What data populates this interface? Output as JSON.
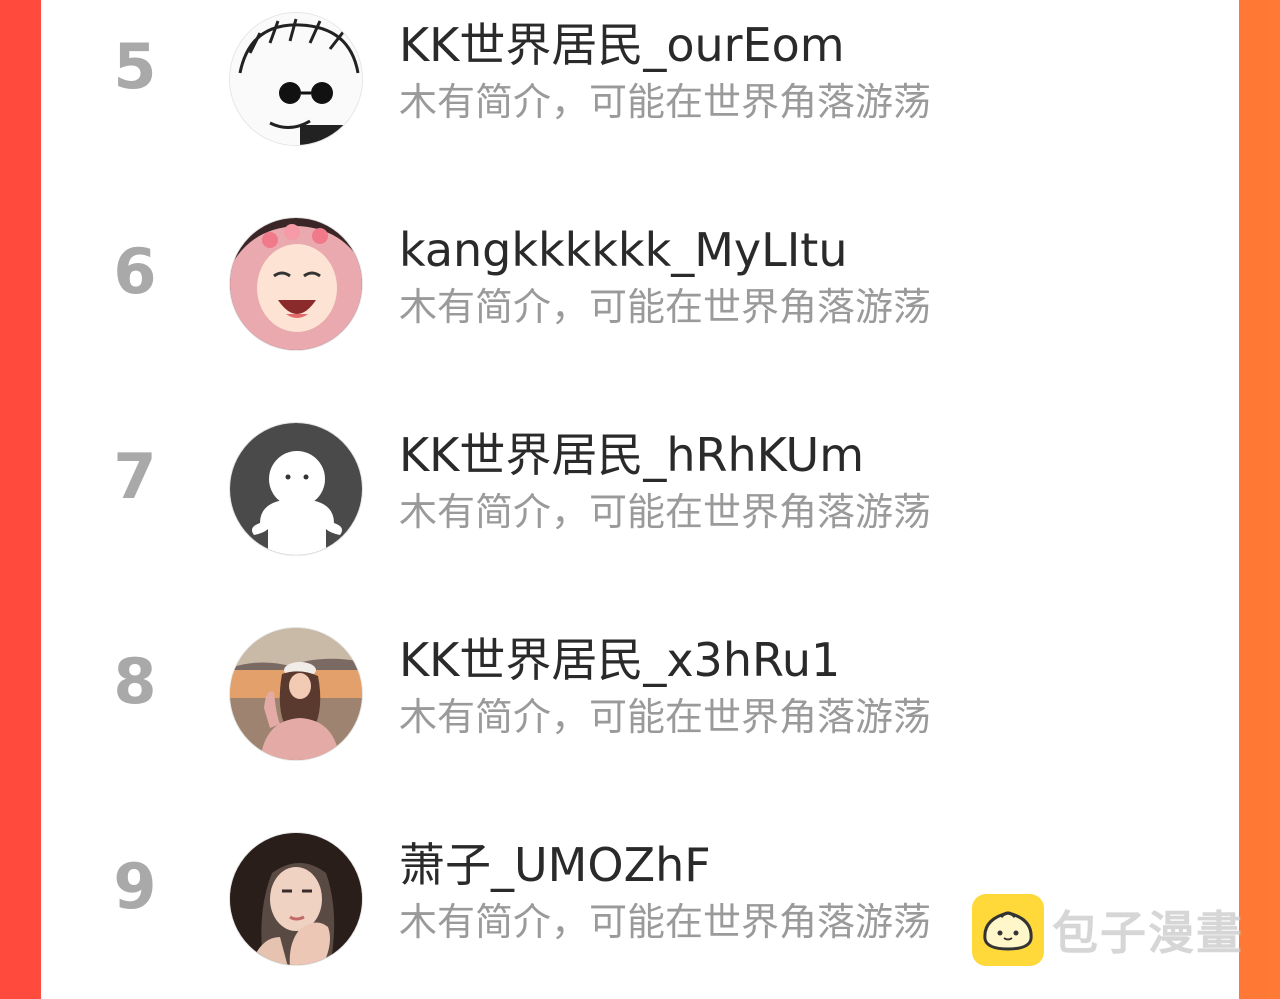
{
  "users": [
    {
      "rank": "5",
      "name": "KK世界居民_ourEom",
      "bio": "木有简介，可能在世界角落游荡",
      "avatar": "cartoon-glasses-avatar"
    },
    {
      "rank": "6",
      "name": "kangkkkkkk_MyLItu",
      "bio": "木有简介，可能在世界角落游荡",
      "avatar": "anime-girl-avatar"
    },
    {
      "rank": "7",
      "name": "KK世界居民_hRhKUm",
      "bio": "木有简介，可能在世界角落游荡",
      "avatar": "default-ghost-avatar"
    },
    {
      "rank": "8",
      "name": "KK世界居民_x3hRu1",
      "bio": "木有简介，可能在世界角落游荡",
      "avatar": "beach-girl-avatar"
    },
    {
      "rank": "9",
      "name": "萧子_UMOZhF",
      "bio": "木有简介，可能在世界角落游荡",
      "avatar": "selfie-girl-avatar"
    }
  ],
  "watermark": {
    "text": "包子漫畫",
    "icon": "bun-icon"
  },
  "colors": {
    "background_left": "#ff4a3d",
    "background_right": "#ff7a35",
    "card": "#ffffff",
    "rank": "#a9a9a9",
    "name": "#2a2a2a",
    "bio": "#9a9a9a"
  }
}
